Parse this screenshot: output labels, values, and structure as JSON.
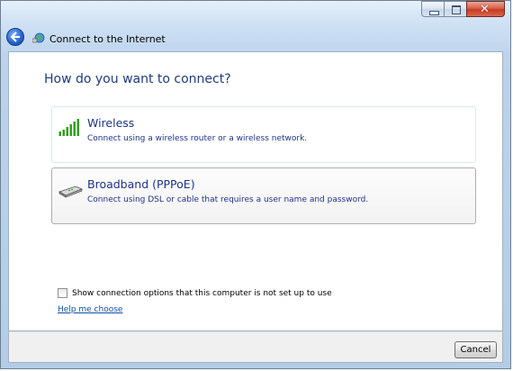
{
  "window": {
    "title": "Connect to the Internet",
    "icon": "network-globe-icon"
  },
  "caption_buttons": {
    "minimize_icon": "minimize-icon",
    "maximize_icon": "maximize-icon",
    "close_icon": "close-icon",
    "close_glyph": "✕"
  },
  "main": {
    "question": "How do you want to connect?",
    "options": [
      {
        "title": "Wireless",
        "description": "Connect using a wireless router or a wireless network.",
        "icon": "signal-bars-icon"
      },
      {
        "title": "Broadband (PPPoE)",
        "description": "Connect using DSL or cable that requires a user name and password.",
        "icon": "broadband-modem-icon"
      }
    ],
    "show_options_label": "Show connection options that this computer is not set up to use",
    "show_options_checked": false,
    "help_link": "Help me choose"
  },
  "footer": {
    "cancel_label": "Cancel"
  },
  "colors": {
    "heading": "#1f3c7a",
    "option_text": "#1e3287",
    "link": "#0b4fa8"
  }
}
